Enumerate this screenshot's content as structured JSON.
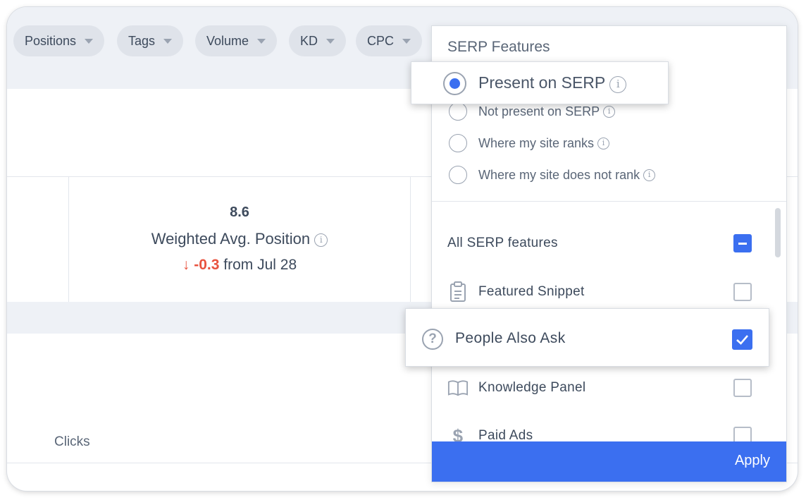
{
  "filters": [
    "Positions",
    "Tags",
    "Volume",
    "KD",
    "CPC"
  ],
  "metric": {
    "value": "8.6",
    "label": "Weighted Avg. Position",
    "delta_arrow": "↓",
    "delta": "-0.3",
    "delta_suffix": "from Jul 28"
  },
  "chart": {
    "clicks_label": "Clicks"
  },
  "serp_panel": {
    "title": "SERP Features",
    "radio_options": [
      {
        "label": "Present on SERP",
        "selected": true
      },
      {
        "label": "Not present on SERP",
        "selected": false
      },
      {
        "label": "Where my site ranks",
        "selected": false
      },
      {
        "label": "Where my site does not rank",
        "selected": false
      }
    ],
    "all_features_label": "All SERP features",
    "all_features_state": "indeterminate",
    "features": [
      {
        "label": "Featured Snippet",
        "icon": "clipboard-icon",
        "checked": false
      },
      {
        "label": "People Also Ask",
        "icon": "question-circle-icon",
        "checked": true
      },
      {
        "label": "Knowledge Panel",
        "icon": "book-icon",
        "checked": false
      },
      {
        "label": "Paid Ads",
        "icon": "dollar-icon",
        "checked": false
      }
    ],
    "apply_label": "Apply"
  },
  "colors": {
    "accent": "#3b6ff0",
    "negative": "#e8533f",
    "background_band": "#eef1f6"
  }
}
